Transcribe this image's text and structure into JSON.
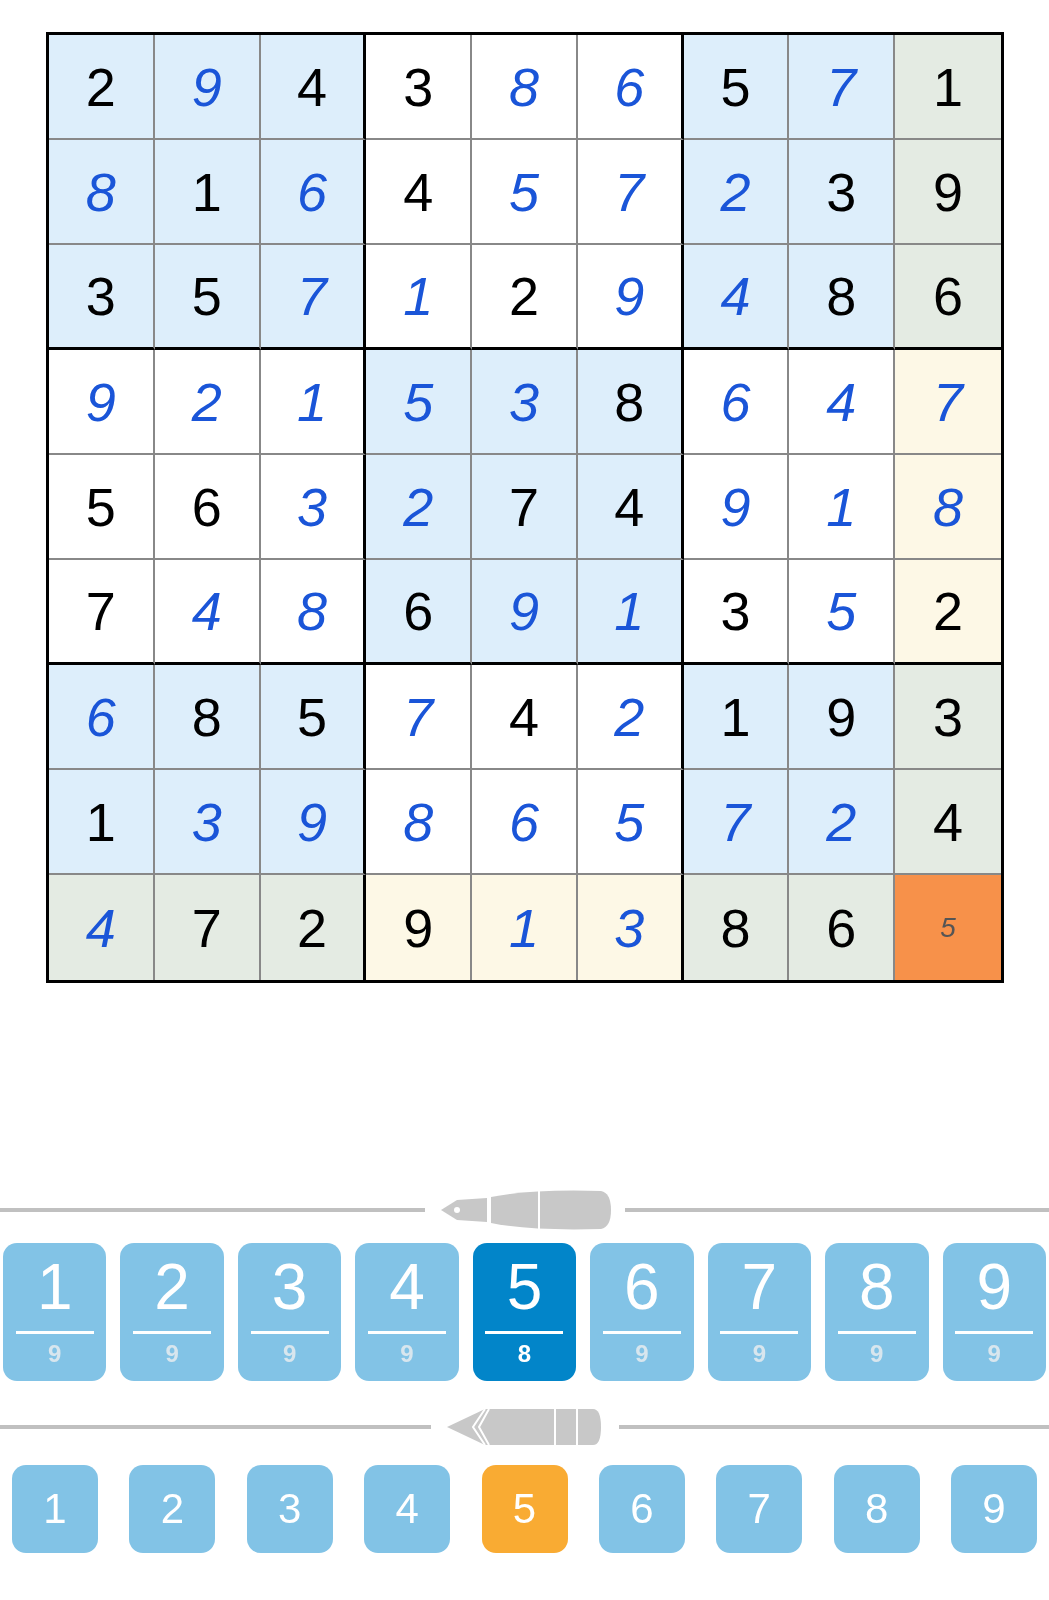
{
  "board": {
    "rows": [
      [
        {
          "value": "2",
          "kind": "given",
          "selected": false
        },
        {
          "value": "9",
          "kind": "entered",
          "selected": false
        },
        {
          "value": "4",
          "kind": "given",
          "selected": false
        },
        {
          "value": "3",
          "kind": "given",
          "selected": false
        },
        {
          "value": "8",
          "kind": "entered",
          "selected": false
        },
        {
          "value": "6",
          "kind": "entered",
          "selected": false
        },
        {
          "value": "5",
          "kind": "given",
          "selected": false
        },
        {
          "value": "7",
          "kind": "entered",
          "selected": false
        },
        {
          "value": "1",
          "kind": "given",
          "selected": false
        }
      ],
      [
        {
          "value": "8",
          "kind": "entered",
          "selected": false
        },
        {
          "value": "1",
          "kind": "given",
          "selected": false
        },
        {
          "value": "6",
          "kind": "entered",
          "selected": false
        },
        {
          "value": "4",
          "kind": "given",
          "selected": false
        },
        {
          "value": "5",
          "kind": "entered",
          "selected": false
        },
        {
          "value": "7",
          "kind": "entered",
          "selected": false
        },
        {
          "value": "2",
          "kind": "entered",
          "selected": false
        },
        {
          "value": "3",
          "kind": "given",
          "selected": false
        },
        {
          "value": "9",
          "kind": "given",
          "selected": false
        }
      ],
      [
        {
          "value": "3",
          "kind": "given",
          "selected": false
        },
        {
          "value": "5",
          "kind": "given",
          "selected": false
        },
        {
          "value": "7",
          "kind": "entered",
          "selected": false
        },
        {
          "value": "1",
          "kind": "entered",
          "selected": false
        },
        {
          "value": "2",
          "kind": "given",
          "selected": false
        },
        {
          "value": "9",
          "kind": "entered",
          "selected": false
        },
        {
          "value": "4",
          "kind": "entered",
          "selected": false
        },
        {
          "value": "8",
          "kind": "given",
          "selected": false
        },
        {
          "value": "6",
          "kind": "given",
          "selected": false
        }
      ],
      [
        {
          "value": "9",
          "kind": "entered",
          "selected": false
        },
        {
          "value": "2",
          "kind": "entered",
          "selected": false
        },
        {
          "value": "1",
          "kind": "entered",
          "selected": false
        },
        {
          "value": "5",
          "kind": "entered",
          "selected": false
        },
        {
          "value": "3",
          "kind": "entered",
          "selected": false
        },
        {
          "value": "8",
          "kind": "given",
          "selected": false
        },
        {
          "value": "6",
          "kind": "entered",
          "selected": false
        },
        {
          "value": "4",
          "kind": "entered",
          "selected": false
        },
        {
          "value": "7",
          "kind": "entered",
          "selected": false
        }
      ],
      [
        {
          "value": "5",
          "kind": "given",
          "selected": false
        },
        {
          "value": "6",
          "kind": "given",
          "selected": false
        },
        {
          "value": "3",
          "kind": "entered",
          "selected": false
        },
        {
          "value": "2",
          "kind": "entered",
          "selected": false
        },
        {
          "value": "7",
          "kind": "given",
          "selected": false
        },
        {
          "value": "4",
          "kind": "given",
          "selected": false
        },
        {
          "value": "9",
          "kind": "entered",
          "selected": false
        },
        {
          "value": "1",
          "kind": "entered",
          "selected": false
        },
        {
          "value": "8",
          "kind": "entered",
          "selected": false
        }
      ],
      [
        {
          "value": "7",
          "kind": "given",
          "selected": false
        },
        {
          "value": "4",
          "kind": "entered",
          "selected": false
        },
        {
          "value": "8",
          "kind": "entered",
          "selected": false
        },
        {
          "value": "6",
          "kind": "given",
          "selected": false
        },
        {
          "value": "9",
          "kind": "entered",
          "selected": false
        },
        {
          "value": "1",
          "kind": "entered",
          "selected": false
        },
        {
          "value": "3",
          "kind": "given",
          "selected": false
        },
        {
          "value": "5",
          "kind": "entered",
          "selected": false
        },
        {
          "value": "2",
          "kind": "given",
          "selected": false
        }
      ],
      [
        {
          "value": "6",
          "kind": "entered",
          "selected": false
        },
        {
          "value": "8",
          "kind": "given",
          "selected": false
        },
        {
          "value": "5",
          "kind": "given",
          "selected": false
        },
        {
          "value": "7",
          "kind": "entered",
          "selected": false
        },
        {
          "value": "4",
          "kind": "given",
          "selected": false
        },
        {
          "value": "2",
          "kind": "entered",
          "selected": false
        },
        {
          "value": "1",
          "kind": "given",
          "selected": false
        },
        {
          "value": "9",
          "kind": "given",
          "selected": false
        },
        {
          "value": "3",
          "kind": "given",
          "selected": false
        }
      ],
      [
        {
          "value": "1",
          "kind": "given",
          "selected": false
        },
        {
          "value": "3",
          "kind": "entered",
          "selected": false
        },
        {
          "value": "9",
          "kind": "entered",
          "selected": false
        },
        {
          "value": "8",
          "kind": "entered",
          "selected": false
        },
        {
          "value": "6",
          "kind": "entered",
          "selected": false
        },
        {
          "value": "5",
          "kind": "entered",
          "selected": false
        },
        {
          "value": "7",
          "kind": "entered",
          "selected": false
        },
        {
          "value": "2",
          "kind": "entered",
          "selected": false
        },
        {
          "value": "4",
          "kind": "given",
          "selected": false
        }
      ],
      [
        {
          "value": "4",
          "kind": "entered",
          "selected": false
        },
        {
          "value": "7",
          "kind": "given",
          "selected": false
        },
        {
          "value": "2",
          "kind": "given",
          "selected": false
        },
        {
          "value": "9",
          "kind": "given",
          "selected": false
        },
        {
          "value": "1",
          "kind": "entered",
          "selected": false
        },
        {
          "value": "3",
          "kind": "entered",
          "selected": false
        },
        {
          "value": "8",
          "kind": "given",
          "selected": false
        },
        {
          "value": "6",
          "kind": "given",
          "selected": false
        },
        {
          "value": "5",
          "kind": "note",
          "selected": true
        }
      ]
    ]
  },
  "pen_keys": [
    {
      "digit": "1",
      "count": "9",
      "selected": false
    },
    {
      "digit": "2",
      "count": "9",
      "selected": false
    },
    {
      "digit": "3",
      "count": "9",
      "selected": false
    },
    {
      "digit": "4",
      "count": "9",
      "selected": false
    },
    {
      "digit": "5",
      "count": "8",
      "selected": true
    },
    {
      "digit": "6",
      "count": "9",
      "selected": false
    },
    {
      "digit": "7",
      "count": "9",
      "selected": false
    },
    {
      "digit": "8",
      "count": "9",
      "selected": false
    },
    {
      "digit": "9",
      "count": "9",
      "selected": false
    }
  ],
  "pencil_keys": [
    {
      "digit": "1",
      "selected": false
    },
    {
      "digit": "2",
      "selected": false
    },
    {
      "digit": "3",
      "selected": false
    },
    {
      "digit": "4",
      "selected": false
    },
    {
      "digit": "5",
      "selected": true
    },
    {
      "digit": "6",
      "selected": false
    },
    {
      "digit": "7",
      "selected": false
    },
    {
      "digit": "8",
      "selected": false
    },
    {
      "digit": "9",
      "selected": false
    }
  ]
}
